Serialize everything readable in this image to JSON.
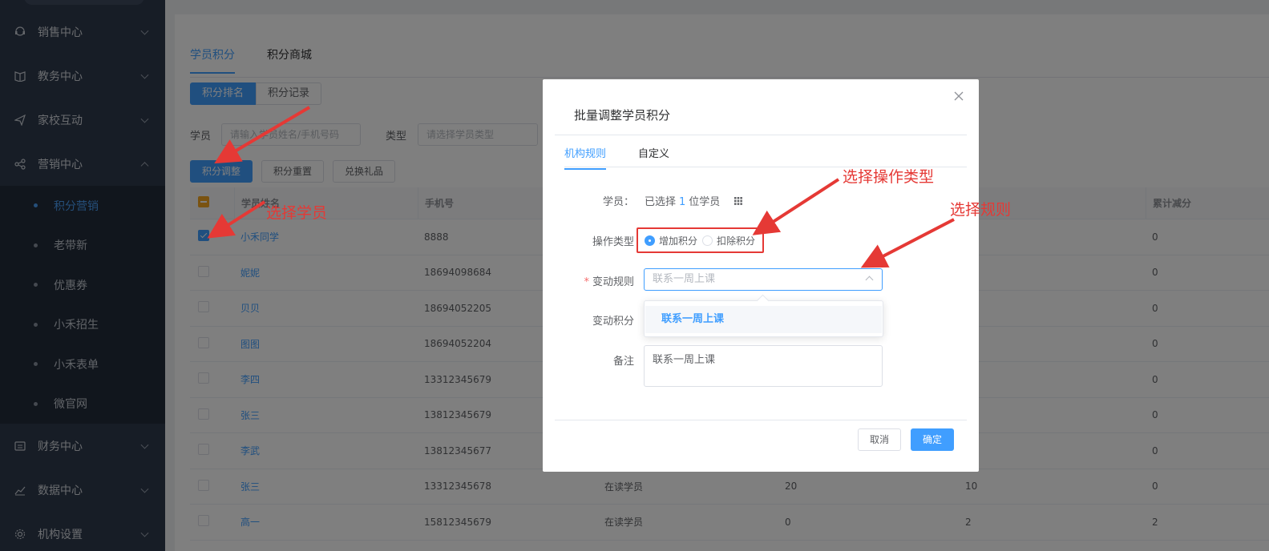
{
  "sidebar": {
    "items": [
      {
        "label": "销售中心",
        "icon": "headset-icon"
      },
      {
        "label": "教务中心",
        "icon": "book-icon"
      },
      {
        "label": "家校互动",
        "icon": "send-icon"
      },
      {
        "label": "营销中心",
        "icon": "share-icon",
        "expanded": true
      }
    ],
    "submenu": [
      {
        "label": "积分营销",
        "active": true
      },
      {
        "label": "老带新"
      },
      {
        "label": "优惠券"
      },
      {
        "label": "小禾招生"
      },
      {
        "label": "小禾表单"
      },
      {
        "label": "微官网"
      }
    ],
    "bottom_items": [
      {
        "label": "财务中心",
        "icon": "wallet-icon"
      },
      {
        "label": "数据中心",
        "icon": "chart-icon"
      },
      {
        "label": "机构设置",
        "icon": "gear-icon"
      }
    ]
  },
  "main": {
    "tabs": [
      "学员积分",
      "积分商城"
    ],
    "segments": [
      "积分排名",
      "积分记录"
    ],
    "filter": {
      "student_label": "学员",
      "student_placeholder": "请输入学员姓名/手机号码",
      "type_label": "类型",
      "type_placeholder": "请选择学员类型"
    },
    "buttons": [
      "积分调整",
      "积分重置",
      "兑换礼品"
    ],
    "table": {
      "headers": [
        "学员姓名",
        "手机号",
        "",
        "",
        "",
        "累计减分"
      ],
      "rows": [
        {
          "name": "小禾同学",
          "phone": "8888",
          "type": "",
          "a": "",
          "b": "",
          "c": "0",
          "checked": true
        },
        {
          "name": "妮妮",
          "phone": "18694098684",
          "type": "",
          "a": "",
          "b": "",
          "c": "0"
        },
        {
          "name": "贝贝",
          "phone": "18694052205",
          "type": "",
          "a": "",
          "b": "",
          "c": "0"
        },
        {
          "name": "图图",
          "phone": "18694052204",
          "type": "",
          "a": "",
          "b": "",
          "c": "0"
        },
        {
          "name": "李四",
          "phone": "13312345679",
          "type": "",
          "a": "",
          "b": "",
          "c": "0"
        },
        {
          "name": "张三",
          "phone": "13812345679",
          "type": "",
          "a": "",
          "b": "",
          "c": "0"
        },
        {
          "name": "李武",
          "phone": "13812345677",
          "type": "",
          "a": "",
          "b": "",
          "c": "0"
        },
        {
          "name": "张三",
          "phone": "13312345678",
          "type": "在读学员",
          "a": "20",
          "b": "10",
          "c": "0"
        },
        {
          "name": "高一",
          "phone": "15812345679",
          "type": "在读学员",
          "a": "0",
          "b": "2",
          "c": "2"
        }
      ]
    }
  },
  "dialog": {
    "title": "批量调整学员积分",
    "tabs": [
      "机构规则",
      "自定义"
    ],
    "student_label": "学员：",
    "student_prefix": "已选择",
    "student_count": "1",
    "student_suffix": "位学员",
    "op_label": "操作类型",
    "op_options": [
      "增加积分",
      "扣除积分"
    ],
    "rule_label": "变动规则",
    "rule_value": "联系一周上课",
    "rule_option": "联系一周上课",
    "points_label": "变动积分",
    "note_label": "备注",
    "note_value": "联系一周上课",
    "cancel": "取消",
    "ok": "确定"
  },
  "annotations": {
    "select_student": "选择学员",
    "select_op": "选择操作类型",
    "select_rule": "选择规则",
    "color": "#e53935"
  },
  "colors": {
    "primary": "#409eff",
    "sidebar": "#2f3a4c",
    "annotation": "#e53935"
  }
}
